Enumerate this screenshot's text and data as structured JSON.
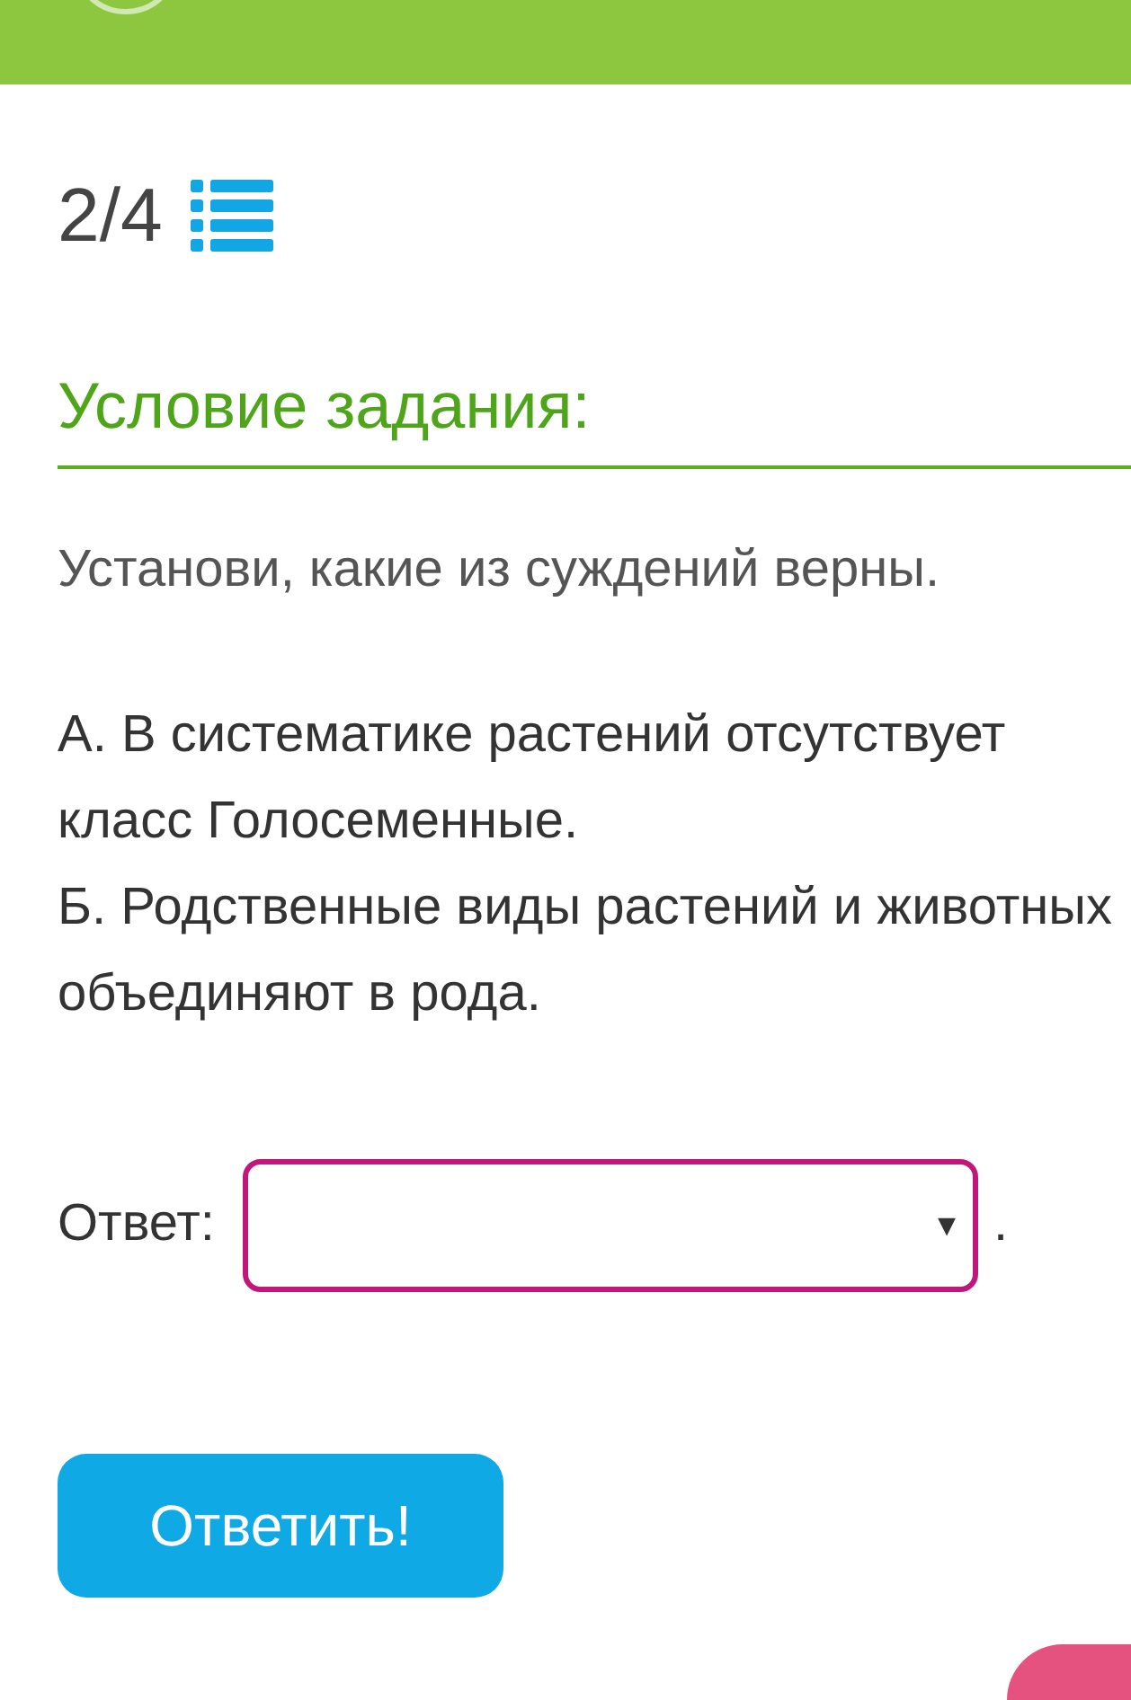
{
  "progress": {
    "counter": "2/4"
  },
  "task": {
    "heading": "Условие задания:",
    "instruction": "Установи, какие из суждений верны.",
    "statements": [
      "А. В систематике растений отсутствует класс Голосеменные.",
      "Б. Родственные виды растений и животных объединяют в рода."
    ]
  },
  "answer": {
    "label": "Ответ:",
    "caret": "▾",
    "suffix": "."
  },
  "submit": {
    "label": "Ответить!"
  }
}
